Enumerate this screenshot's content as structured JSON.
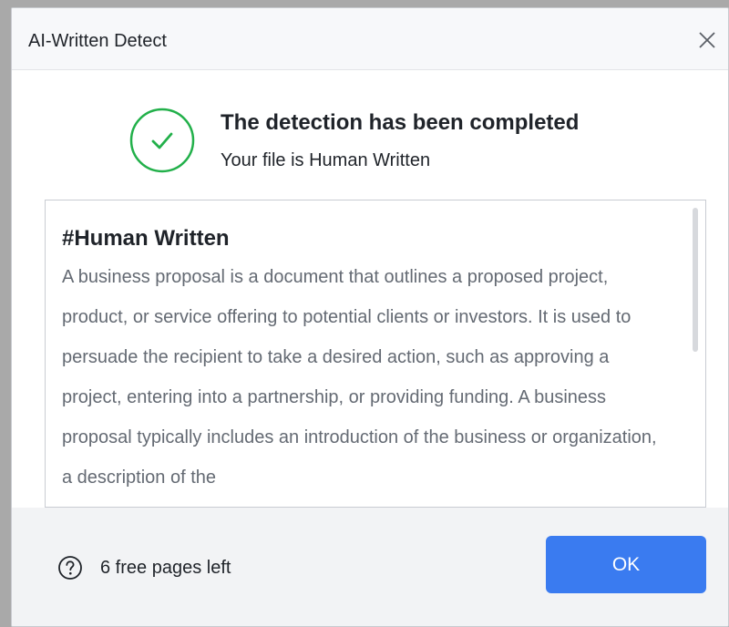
{
  "window": {
    "title": "AI-Written Detect",
    "close_icon": "close-icon"
  },
  "status": {
    "icon": "check-circle-icon",
    "icon_color": "#22b04a",
    "heading": "The detection has been completed",
    "subheading": "Your file is Human Written"
  },
  "result": {
    "label": "#Human Written",
    "text": "A business proposal is a document that outlines a proposed project, product, or service offering to potential clients or investors. It is used to persuade the recipient to take a desired action, such as approving a project, entering into a partnership, or providing funding. A business proposal typically includes an introduction of the business or organization, a description of the"
  },
  "footer": {
    "help_icon": "question-circle-icon",
    "pages_left": "6 free pages left",
    "ok_label": "OK",
    "accent_color": "#3a7bf0"
  }
}
